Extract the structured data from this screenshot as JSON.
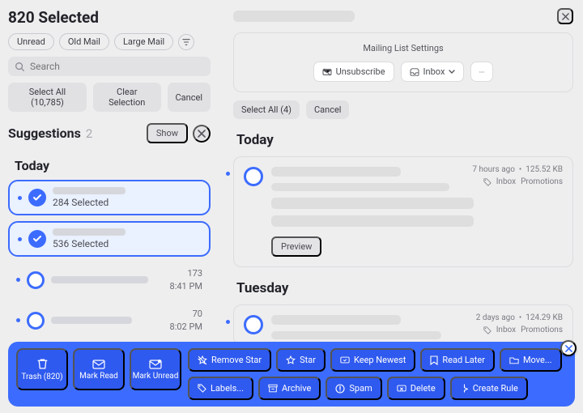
{
  "left": {
    "title": "820 Selected",
    "filters": [
      "Unread",
      "Old Mail",
      "Large Mail"
    ],
    "search_placeholder": "Search",
    "actions": {
      "select_all": "Select All (10,785)",
      "clear": "Clear Selection",
      "cancel": "Cancel"
    },
    "suggestions": {
      "heading": "Suggestions",
      "count": "2",
      "show": "Show"
    },
    "day": "Today",
    "items": [
      {
        "selected": true,
        "sub": "284 Selected"
      },
      {
        "selected": true,
        "sub": "536 Selected"
      },
      {
        "selected": false,
        "count": "173",
        "time": "8:41 PM"
      },
      {
        "selected": false,
        "count": "70",
        "time": "8:02 PM"
      }
    ]
  },
  "right": {
    "panel_title": "Mailing List Settings",
    "unsubscribe": "Unsubscribe",
    "inbox": "Inbox",
    "select_all": "Select All (4)",
    "cancel": "Cancel",
    "groups": [
      {
        "day": "Today",
        "age": "7 hours ago",
        "size": "125.52 KB",
        "label1": "Inbox",
        "label2": "Promotions",
        "preview": "Preview"
      },
      {
        "day": "Tuesday",
        "age": "2 days ago",
        "size": "124.29 KB",
        "label1": "Inbox",
        "label2": "Promotions"
      }
    ]
  },
  "toolbar": {
    "big": [
      {
        "icon": "trash-icon",
        "label": "Trash (820)"
      },
      {
        "icon": "read-icon",
        "label": "Mark Read"
      },
      {
        "icon": "unread-icon",
        "label": "Mark Unread"
      }
    ],
    "small": [
      {
        "icon": "star-off-icon",
        "label": "Remove Star"
      },
      {
        "icon": "star-icon",
        "label": "Star"
      },
      {
        "icon": "keep-icon",
        "label": "Keep Newest"
      },
      {
        "icon": "bookmark-icon",
        "label": "Read Later"
      },
      {
        "icon": "folder-icon",
        "label": "Move..."
      },
      {
        "icon": "tag-icon",
        "label": "Labels..."
      },
      {
        "icon": "archive-icon",
        "label": "Archive"
      },
      {
        "icon": "spam-icon",
        "label": "Spam"
      },
      {
        "icon": "delete-icon",
        "label": "Delete"
      },
      {
        "icon": "rule-icon",
        "label": "Create Rule"
      }
    ]
  }
}
